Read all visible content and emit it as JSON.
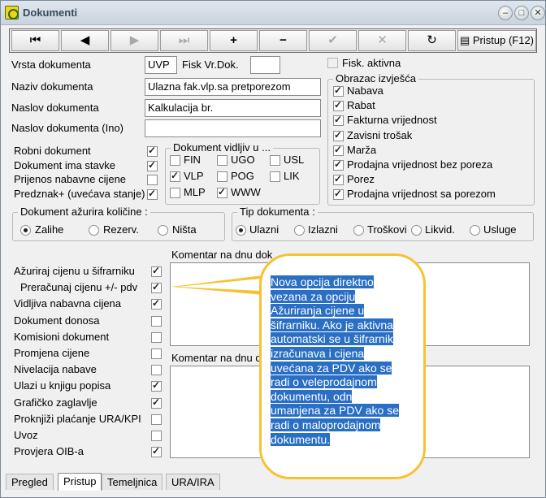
{
  "window": {
    "title": "Dokumenti"
  },
  "toolbar": {
    "first": "⏮",
    "prev": "◀",
    "next": "▶",
    "last": "⏭",
    "add": "+",
    "remove": "−",
    "confirm": "✔",
    "cancel": "✕",
    "refresh": "↻",
    "pristup": "Pristup (F12)"
  },
  "fields": {
    "vrsta_label": "Vrsta dokumenta",
    "vrsta_value": "UVP",
    "fisk_label": "Fisk Vr.Dok.",
    "fisk_value": "",
    "fisk_aktivna": "Fisk. aktivna",
    "naziv_label": "Naziv dokumenta",
    "naziv_value": "Ulazna fak.vlp.sa pretporezom",
    "naslov_label": "Naslov dokumenta",
    "naslov_value": "Kalkulacija br.",
    "naslov_ino_label": "Naslov dokumenta (Ino)",
    "naslov_ino_value": ""
  },
  "flags": [
    {
      "label": "Robni dokument",
      "checked": true
    },
    {
      "label": "Dokument ima stavke",
      "checked": true
    },
    {
      "label": "Prijenos nabavne cijene",
      "checked": false
    },
    {
      "label": "Predznak+ (uvećava stanje)",
      "checked": true
    }
  ],
  "vidljiv": {
    "caption": "Dokument vidljiv u ...",
    "items": [
      {
        "label": "FIN",
        "checked": false
      },
      {
        "label": "UGO",
        "checked": false
      },
      {
        "label": "USL",
        "checked": false
      },
      {
        "label": "VLP",
        "checked": true
      },
      {
        "label": "POG",
        "checked": false
      },
      {
        "label": "LIK",
        "checked": false
      },
      {
        "label": "MLP",
        "checked": false
      },
      {
        "label": "WWW",
        "checked": true
      }
    ]
  },
  "obrazac": {
    "caption": "Obrazac izvješća",
    "items": [
      {
        "label": "Nabava",
        "checked": true
      },
      {
        "label": "Rabat",
        "checked": true
      },
      {
        "label": "Fakturna vrijednost",
        "checked": true
      },
      {
        "label": "Zavisni trošak",
        "checked": true
      },
      {
        "label": "Marža",
        "checked": true
      },
      {
        "label": "Prodajna vrijednost bez poreza",
        "checked": true
      },
      {
        "label": "Porez",
        "checked": true
      },
      {
        "label": "Prodajna vrijednost sa porezom",
        "checked": true
      }
    ]
  },
  "azurira": {
    "caption": "Dokument ažurira količine :",
    "options": [
      "Zalihe",
      "Rezerv.",
      "Ništa"
    ],
    "selected": 0
  },
  "tip": {
    "caption": "Tip dokumenta :",
    "options": [
      "Ulazni",
      "Izlazni",
      "Troškovi",
      "Likvid.",
      "Usluge"
    ],
    "selected": 0
  },
  "options": [
    {
      "label": "Ažuriraj cijenu u šifrarniku",
      "checked": true
    },
    {
      "label": "Preračunaj cijenu +/- pdv",
      "checked": true
    },
    {
      "label": "Vidljiva nabavna cijena",
      "checked": true
    },
    {
      "label": "Dokument donosa",
      "checked": false
    },
    {
      "label": "Komisioni dokument",
      "checked": false
    },
    {
      "label": "Promjena cijene",
      "checked": false
    },
    {
      "label": "Nivelacija nabave",
      "checked": false
    },
    {
      "label": "Ulazi u knjigu popisa",
      "checked": true
    },
    {
      "label": "Grafičko zaglavlje",
      "checked": true
    },
    {
      "label": "Proknjiži plaćanje URA/KPI",
      "checked": false
    },
    {
      "label": "Uvoz",
      "checked": false
    },
    {
      "label": "Provjera OIB-a",
      "checked": true
    }
  ],
  "komentar1": "Komentar na dnu dok",
  "komentar2": "Komentar na dnu d",
  "callout": "Nova opcija direktno vezana za opciju Ažuriranja cijene u šifrarniku. Ako je aktivna automatski se u šifrarnik izračunava i cijena uvećana za PDV ako se radi o veleprodajnom dokumentu, odn umanjena za PDV ako se radi o maloprodajnom dokumentu.",
  "callout_lines": [
    "Nova opcija direktno",
    "vezana za opciju",
    "Ažuriranja cijene u",
    "šifrarniku. Ako je aktivna",
    "automatski se u šifrarnik",
    "izračunava i cijena",
    "uvećana za PDV ako se",
    "radi o veleprodajnom",
    "dokumentu, odn",
    "umanjena za PDV ako se",
    "radi o maloprodajnom",
    "dokumentu."
  ],
  "tabs": [
    "Pregled",
    "Pristup",
    "Temeljnica",
    "URA/IRA"
  ],
  "active_tab": 1,
  "colors": {
    "callout_border": "#f6c233",
    "highlight": "#2a6fc4"
  }
}
